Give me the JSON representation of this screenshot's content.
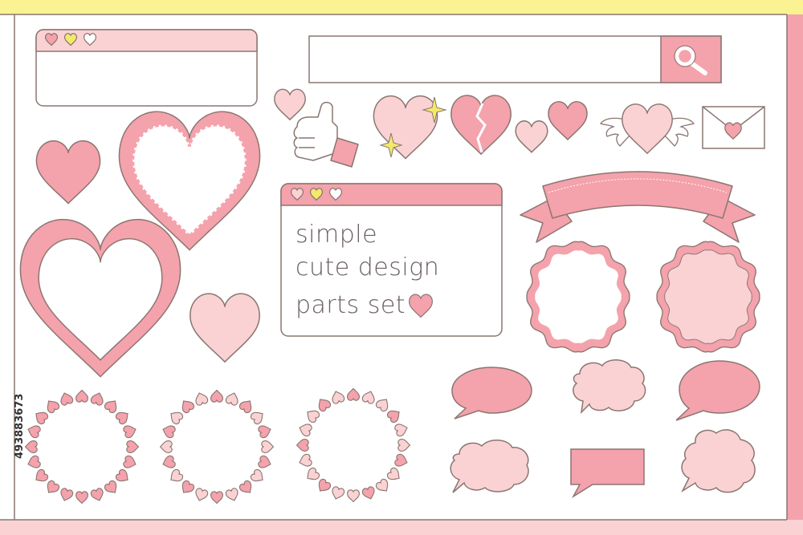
{
  "card": {
    "line1": "simple",
    "line2": "cute design",
    "line3": "parts set"
  },
  "stock_id": "493883673",
  "colors": {
    "pink": "#f4a2ac",
    "pink_light": "#fad2d4",
    "outline": "#8a7670",
    "yellow": "#fbf391",
    "gold": "#f3e96a",
    "white": "#ffffff"
  },
  "icons": [
    "heart-icon",
    "search-icon",
    "thumbs-up-icon",
    "sparkle-icon",
    "broken-heart-icon",
    "winged-heart-icon",
    "envelope-icon",
    "ribbon-banner",
    "scalloped-frame",
    "heart-wreath",
    "speech-bubble",
    "thought-cloud"
  ]
}
